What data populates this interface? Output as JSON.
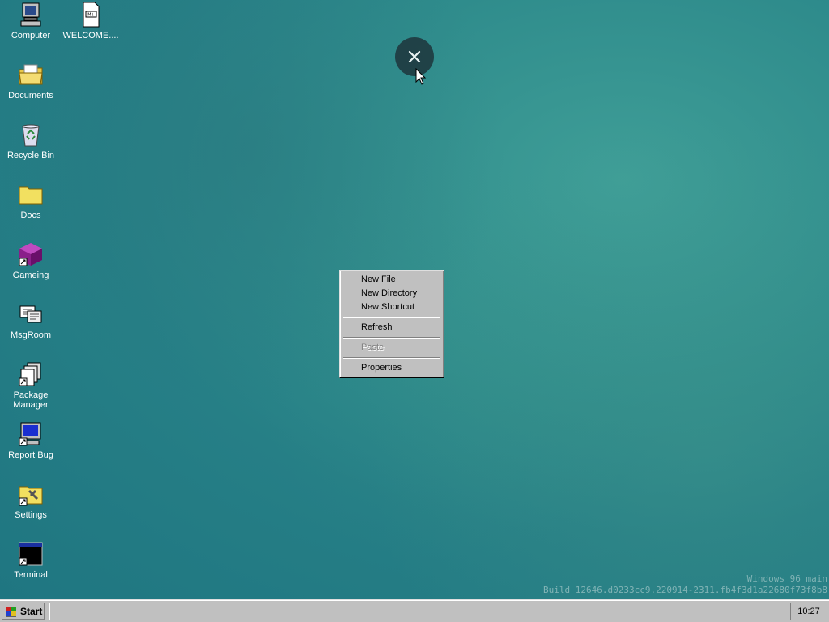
{
  "desktop_icons": [
    {
      "label": "Computer",
      "icon": "computer-icon"
    },
    {
      "label": "WELCOME....",
      "icon": "markdown-file-icon"
    },
    {
      "label": "Documents",
      "icon": "documents-folder-icon"
    },
    {
      "label": "Recycle Bin",
      "icon": "recycle-bin-icon"
    },
    {
      "label": "Docs",
      "icon": "folder-icon"
    },
    {
      "label": "Gameing",
      "icon": "game-cube-icon"
    },
    {
      "label": "MsgRoom",
      "icon": "chat-icon"
    },
    {
      "label": "Package Manager",
      "icon": "package-icon"
    },
    {
      "label": "Report Bug",
      "icon": "monitor-icon"
    },
    {
      "label": "Settings",
      "icon": "settings-folder-icon"
    },
    {
      "label": "Terminal",
      "icon": "terminal-icon"
    }
  ],
  "context_menu": {
    "items": [
      "New File",
      "New Directory",
      "New Shortcut",
      "Refresh",
      "Paste",
      "Properties"
    ],
    "disabled": [
      "Paste"
    ]
  },
  "overlay": {
    "close_icon": "close-icon"
  },
  "watermark": {
    "line1": "Windows 96 main",
    "line2": "Build 12646.d0233cc9.220914-2311.fb4f3d1a22680f73f8b8"
  },
  "taskbar": {
    "start_label": "Start",
    "clock": "10:27"
  },
  "colors": {
    "desktop": "#2f8c8c",
    "taskbar": "#c0c0c0",
    "close_bubble": "#1f3a40"
  }
}
